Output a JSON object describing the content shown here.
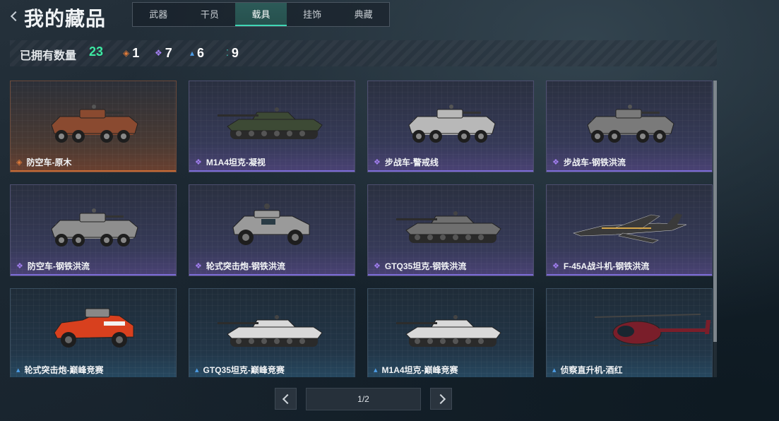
{
  "header": {
    "title": "我的藏品",
    "tabs": [
      {
        "label": "武器",
        "active": false
      },
      {
        "label": "干员",
        "active": false
      },
      {
        "label": "载具",
        "active": true
      },
      {
        "label": "挂饰",
        "active": false
      },
      {
        "label": "典藏",
        "active": false
      }
    ]
  },
  "ownership": {
    "label": "已拥有数量",
    "total": "23",
    "rarities": [
      {
        "icon": "orange-diamond-icon",
        "color": "#e07b3a",
        "count": "1"
      },
      {
        "icon": "purple-diamond-icon",
        "color": "#a27ef0",
        "count": "7"
      },
      {
        "icon": "blue-diamond-icon",
        "color": "#4d9de6",
        "count": "6"
      },
      {
        "icon": "teal-dots-icon",
        "color": "#3ccfbf",
        "count": "9"
      }
    ]
  },
  "items": [
    {
      "name": "防空车-原木",
      "rarity": "orange",
      "vehicle": "wheeled-apc",
      "body_color": "#8a4a30"
    },
    {
      "name": "M1A4坦克-凝视",
      "rarity": "purple",
      "vehicle": "tank",
      "body_color": "#3d4a35"
    },
    {
      "name": "步战车-警戒线",
      "rarity": "purple",
      "vehicle": "wheeled-apc",
      "body_color": "#b8b8b8"
    },
    {
      "name": "步战车-钢铁洪流",
      "rarity": "purple",
      "vehicle": "wheeled-apc",
      "body_color": "#7a7a7a"
    },
    {
      "name": "防空车-钢铁洪流",
      "rarity": "purple",
      "vehicle": "wheeled-apc",
      "body_color": "#8e8e8e"
    },
    {
      "name": "轮式突击炮-钢铁洪流",
      "rarity": "purple",
      "vehicle": "armored-car",
      "body_color": "#9a9a9a"
    },
    {
      "name": "GTQ35坦克-钢铁洪流",
      "rarity": "purple",
      "vehicle": "tank",
      "body_color": "#6f6f6f"
    },
    {
      "name": "F-45A战斗机-钢铁洪流",
      "rarity": "purple",
      "vehicle": "jet",
      "body_color": "#3a3a3a"
    },
    {
      "name": "轮式突击炮-巅峰竞赛",
      "rarity": "blue",
      "vehicle": "buggy",
      "body_color": "#d8401e"
    },
    {
      "name": "GTQ35坦克-巅峰竞赛",
      "rarity": "blue",
      "vehicle": "tank",
      "body_color": "#d9d9d9"
    },
    {
      "name": "M1A4坦克-巅峰竞赛",
      "rarity": "blue",
      "vehicle": "tank",
      "body_color": "#d9d9d9"
    },
    {
      "name": "侦察直升机-酒红",
      "rarity": "blue",
      "vehicle": "helicopter",
      "body_color": "#7a1e2a"
    }
  ],
  "pagination": {
    "label": "1/2"
  }
}
